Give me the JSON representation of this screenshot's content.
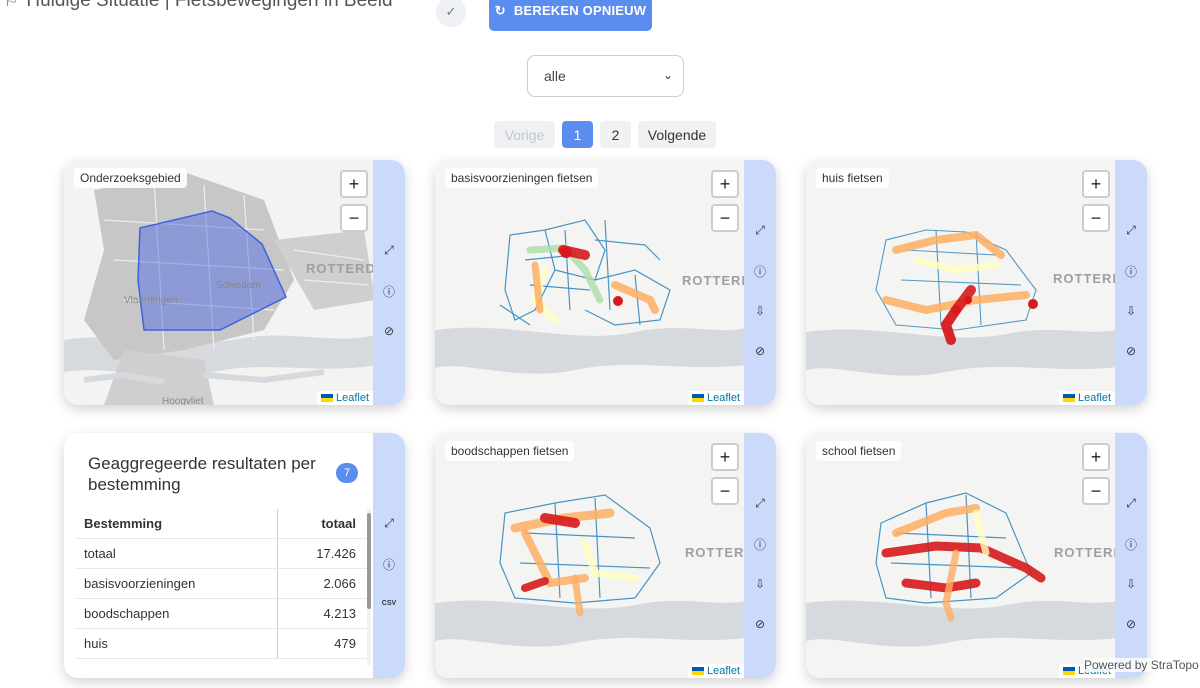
{
  "header": {
    "title": "Huidige Situatie | Fietsbewegingen in Beeld",
    "title_icon": "map-icon",
    "check_icon": "check-icon",
    "recalc_icon": "refresh-icon",
    "recalc_label": "BEREKEN OPNIEUW"
  },
  "filter": {
    "selected": "alle"
  },
  "pagination": {
    "prev": "Vorige",
    "pages": [
      "1",
      "2"
    ],
    "active": "1",
    "next": "Volgende"
  },
  "maps": {
    "onderzoeksgebied": {
      "title": "Onderzoeksgebied",
      "labels": [
        "ROTTERDA",
        "Vlaardingen",
        "Schiedam",
        "Hoogvliet"
      ]
    },
    "basis": {
      "title": "basisvoorzieningen fietsen",
      "labels": [
        "ROTTERD"
      ]
    },
    "huis": {
      "title": "huis fietsen",
      "labels": [
        "ROTTERDA"
      ]
    },
    "boodschappen": {
      "title": "boodschappen fietsen",
      "labels": [
        "ROTTERD"
      ]
    },
    "school": {
      "title": "school fietsen",
      "labels": [
        "ROTTERDA"
      ]
    }
  },
  "map_controls": {
    "zoom_in": "+",
    "zoom_out": "−",
    "attribution": "Leaflet"
  },
  "aggregated": {
    "title": "Geaggregeerde resultaten per bestemming",
    "count": "7",
    "columns": [
      "Bestemming",
      "totaal"
    ],
    "rows": [
      [
        "totaal",
        "17.426"
      ],
      [
        "basisvoorzieningen",
        "2.066"
      ],
      [
        "boodschappen",
        "4.213"
      ],
      [
        "huis",
        "479"
      ]
    ]
  },
  "side_icons": [
    "expand-icon",
    "info-icon",
    "map-download-icon",
    "compass-icon"
  ],
  "aggregated_side_icons": [
    "expand-icon",
    "info-icon",
    "csv-download-icon"
  ],
  "csv_label": "CSV",
  "footer": {
    "powered": "Powered by StraTopo"
  },
  "colors": {
    "accent": "#5b8def",
    "side_panel": "#cbd9fb",
    "heat_high": "#d7191c",
    "heat_mid": "#fdae61",
    "heat_low": "#2b83ba"
  }
}
